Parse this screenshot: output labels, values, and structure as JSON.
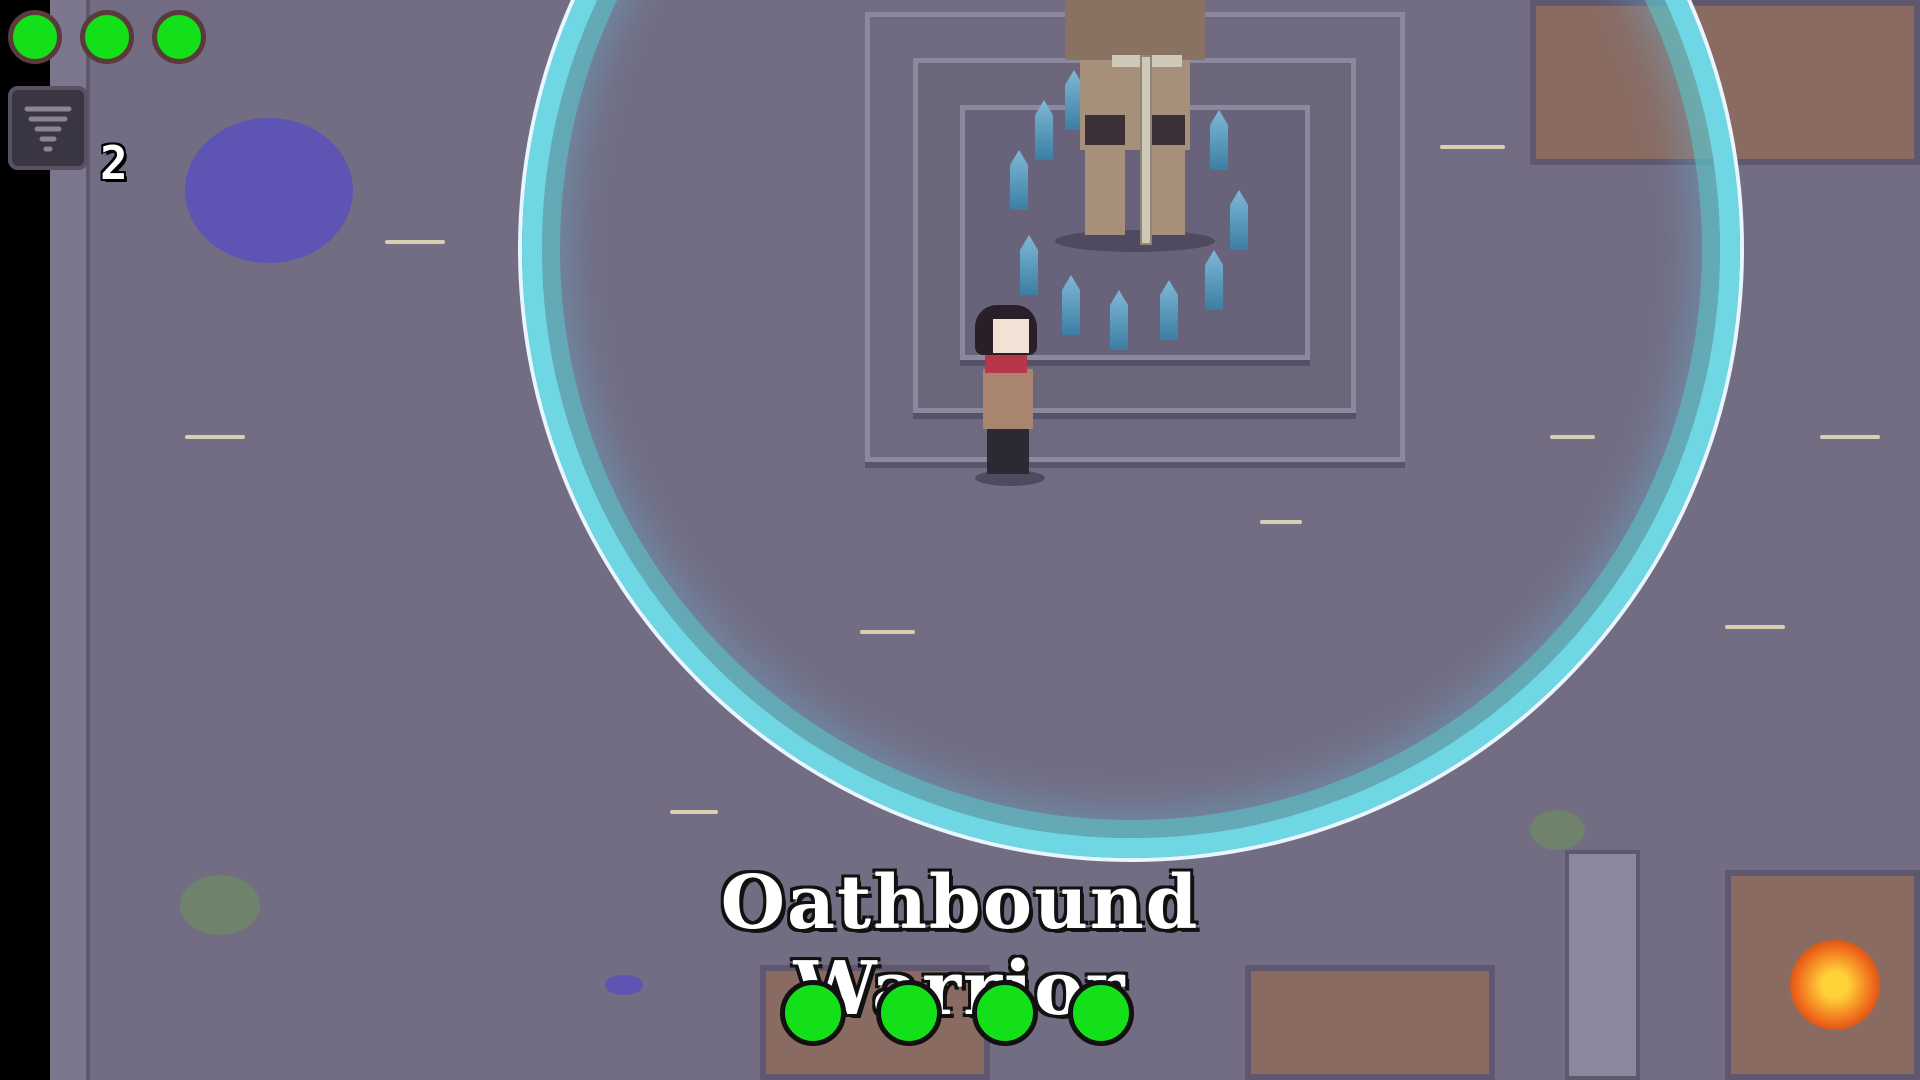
{
  "hud": {
    "player_health": {
      "filled": 3,
      "max": 3,
      "color": "#14e01a"
    },
    "item": {
      "icon": "tornado-icon",
      "count": "2"
    }
  },
  "boss": {
    "name": "Oathbound Warrior",
    "health": {
      "filled": 4,
      "max": 4,
      "color": "#14e01a"
    }
  },
  "colors": {
    "ground": "#726d82",
    "energy_ring": "#6fd6e4",
    "puddle": "#5b51b8"
  }
}
